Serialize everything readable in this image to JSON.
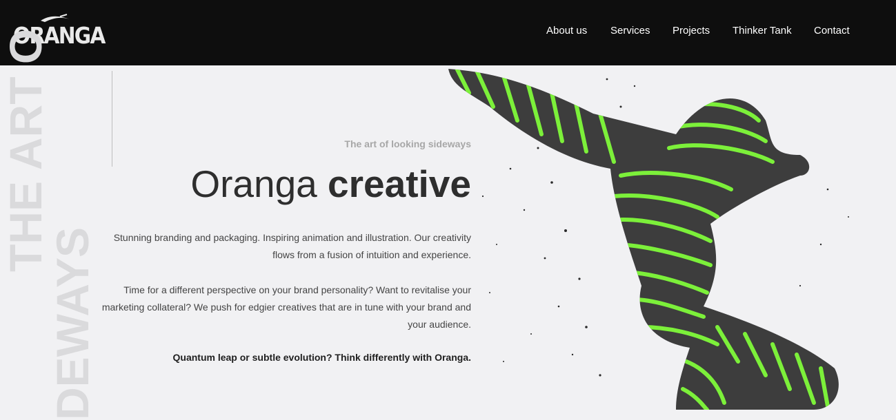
{
  "brand": {
    "logo_text": "ORANGA"
  },
  "nav": {
    "items": [
      {
        "label": "About us"
      },
      {
        "label": "Services"
      },
      {
        "label": "Projects"
      },
      {
        "label": "Thinker Tank"
      },
      {
        "label": "Contact"
      }
    ]
  },
  "hero": {
    "side_text_1": "THE ART O",
    "side_text_2": "DEWAYS",
    "tagline": "The art of looking sideways",
    "headline_light": "Oranga",
    "headline_bold": "creative",
    "paragraph_1": "Stunning branding and packaging. Inspiring animation and illustration. Our creativity flows from a fusion of intuition and experience.",
    "paragraph_2": "Time for a different perspective on your brand personality? Want to revitalise your marketing collateral? We push for edgier creatives that are in tune with your brand and your audience.",
    "cta_text": "Quantum leap or subtle evolution? Think differently with Oranga."
  },
  "colors": {
    "header_bg": "#0e0e0e",
    "page_bg": "#f1f1f3",
    "accent_green": "#7cf03a",
    "figure_dark": "#3d3d3d"
  },
  "icons": {
    "logo_leaf": "leaf-icon"
  }
}
